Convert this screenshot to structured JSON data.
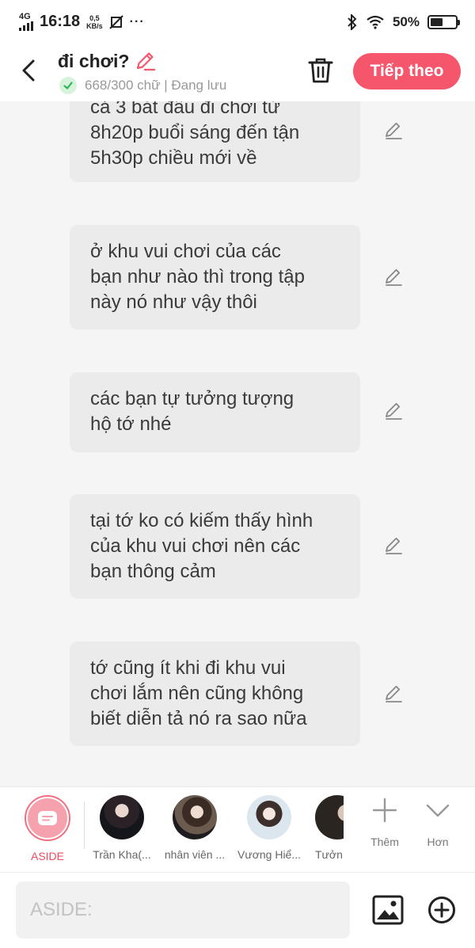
{
  "status_bar": {
    "network": "4G",
    "time": "16:18",
    "speed_value": "0,5",
    "speed_unit": "KB/s",
    "dots": "···",
    "battery_text": "50%",
    "battery_level": 0.5
  },
  "header": {
    "title": "đi chơi?",
    "word_count": "668/300 chữ | Đang lưu",
    "next_label": "Tiếp theo",
    "accent_color": "#f5566c"
  },
  "messages": [
    {
      "lines": [
        "cả 3 bắt đầu đi chơi từ",
        "8h20p buổi sáng đến tận",
        "5h30p chiều mới về"
      ]
    },
    {
      "lines": [
        "ở khu vui chơi của các",
        "bạn như nào thì trong tập",
        "này nó như vậy thôi"
      ]
    },
    {
      "lines": [
        "các bạn tự tưởng tượng",
        "hộ tớ nhé"
      ]
    },
    {
      "lines": [
        "tại tớ ko có kiếm thấy hình",
        "của khu vui chơi nên các",
        "bạn thông cảm"
      ]
    },
    {
      "lines": [
        "tớ cũng ít khi đi khu vui",
        "chơi lắm nên cũng không",
        "biết diễn tả nó ra sao nữa"
      ]
    }
  ],
  "characters": [
    {
      "name": "ASIDE"
    },
    {
      "name": "Trần Kha(..."
    },
    {
      "name": "nhân viên ..."
    },
    {
      "name": "Vương Hiể..."
    },
    {
      "name": "Tưởn"
    }
  ],
  "tools": {
    "add_label": "Thêm",
    "more_label": "Hơn"
  },
  "input": {
    "placeholder": "ASIDE:"
  }
}
